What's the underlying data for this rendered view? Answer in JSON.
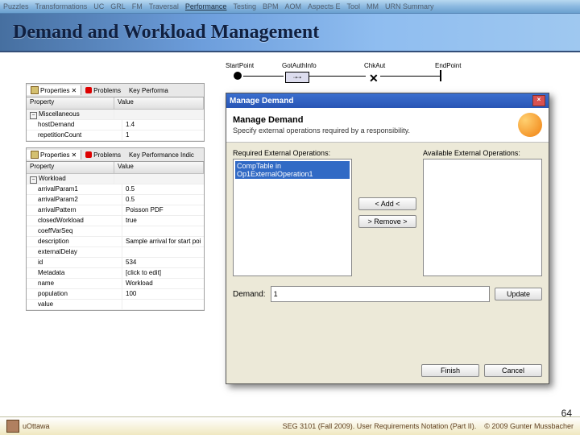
{
  "nav": {
    "items": [
      "Puzzles",
      "Transformations",
      "UC",
      "GRL",
      "FM",
      "Traversal",
      "Performance",
      "Testing",
      "BPM",
      "AOM",
      "Aspects E",
      "Tool",
      "MM",
      "URN Summary"
    ],
    "active_index": 6
  },
  "header": {
    "title": "Demand and Workload Management"
  },
  "panel1": {
    "tabs": {
      "properties": "Properties",
      "problems": "Problems",
      "keyperf": "Key Performa"
    },
    "col_property": "Property",
    "col_value": "Value",
    "group": "Miscellaneous",
    "rows": [
      {
        "k": "hostDemand",
        "v": "1.4"
      },
      {
        "k": "repetitionCount",
        "v": "1"
      }
    ]
  },
  "panel2": {
    "tabs": {
      "properties": "Properties",
      "problems": "Problems",
      "keyperf": "Key Performance Indic"
    },
    "col_property": "Property",
    "col_value": "Value",
    "group": "Workload",
    "rows": [
      {
        "k": "arrivalParam1",
        "v": "0.5"
      },
      {
        "k": "arrivalParam2",
        "v": "0.5"
      },
      {
        "k": "arrivalPattern",
        "v": "Poisson PDF"
      },
      {
        "k": "closedWorkload",
        "v": "true"
      },
      {
        "k": "coeffVarSeq",
        "v": ""
      },
      {
        "k": "description",
        "v": "Sample arrival for start poi"
      },
      {
        "k": "externalDelay",
        "v": ""
      },
      {
        "k": "id",
        "v": "534"
      },
      {
        "k": "Metadata",
        "v": "[click to edit]"
      },
      {
        "k": "name",
        "v": "Workload"
      },
      {
        "k": "population",
        "v": "100"
      },
      {
        "k": "value",
        "v": ""
      }
    ]
  },
  "diagram": {
    "n1": "StartPoint",
    "n2": "GotAuthInfo",
    "n3": "ChkAut",
    "n4": "EndPoint"
  },
  "dialog": {
    "title": "Manage Demand",
    "heading": "Manage Demand",
    "subtitle": "Specify external operations required by a responsibility.",
    "left_label": "Required External Operations:",
    "right_label": "Available External Operations:",
    "selected_item": "CompTable in Op1ExternalOperation1",
    "add": "< Add <",
    "remove": "> Remove >",
    "demand_label": "Demand:",
    "demand_value": "1",
    "update": "Update",
    "finish": "Finish",
    "cancel": "Cancel"
  },
  "footer": {
    "inst": "uOttawa",
    "center": "SEG 3101 (Fall 2009).   User Requirements Notation (Part II).",
    "right": "© 2009 Gunter Mussbacher",
    "page": "64"
  }
}
